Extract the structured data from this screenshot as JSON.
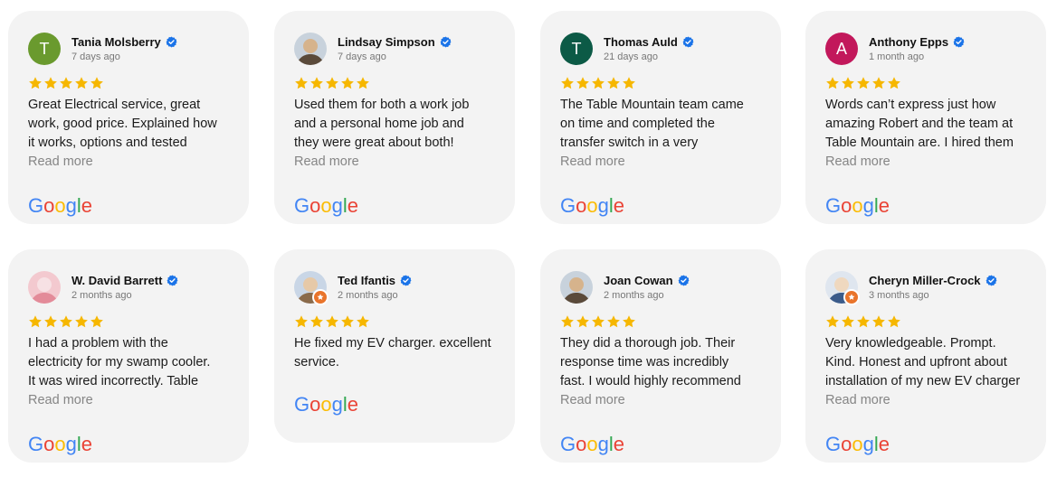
{
  "reviews": [
    {
      "name": "Tania Molsberry",
      "date": "7 days ago",
      "avatar": {
        "type": "initial",
        "letter": "T",
        "color": "#6a9a2e"
      },
      "stars": 5,
      "text": [
        "Great Electrical service, great",
        "work, good price. Explained how",
        "it works, options and tested"
      ],
      "more": "Read more",
      "logo": "Google"
    },
    {
      "name": "Lindsay Simpson",
      "date": "7 days ago",
      "avatar": {
        "type": "photo",
        "icon": "person-photo-icon"
      },
      "stars": 5,
      "text": [
        "Used them for both a work job",
        "and a personal home job and",
        "they were great about both!"
      ],
      "more": "Read more",
      "logo": "Google"
    },
    {
      "name": "Thomas Auld",
      "date": "21 days ago",
      "avatar": {
        "type": "initial",
        "letter": "T",
        "color": "#0c5a46"
      },
      "stars": 5,
      "text": [
        "The Table Mountain team came",
        "on time and completed the",
        "transfer switch in a very"
      ],
      "more": "Read more",
      "logo": "Google"
    },
    {
      "name": "Anthony Epps",
      "date": "1 month ago",
      "avatar": {
        "type": "initial",
        "letter": "A",
        "color": "#c2185b"
      },
      "stars": 5,
      "text": [
        "Words can’t express just how",
        "amazing Robert and the team at",
        "Table Mountain are. I hired them"
      ],
      "more": "Read more",
      "logo": "Google"
    },
    {
      "name": "W. David Barrett",
      "date": "2 months ago",
      "avatar": {
        "type": "photo",
        "icon": "person-photo-icon"
      },
      "stars": 5,
      "text": [
        "I had a problem with the",
        "electricity for my swamp cooler.",
        "It was wired incorrectly. Table"
      ],
      "more": "Read more",
      "logo": "Google"
    },
    {
      "name": "Ted Ifantis",
      "date": "2 months ago",
      "avatar": {
        "type": "photo",
        "icon": "person-photo-icon",
        "badge": true
      },
      "stars": 5,
      "text": [
        "He fixed my EV charger. excellent",
        "service."
      ],
      "more": "",
      "logo": "Google"
    },
    {
      "name": "Joan Cowan",
      "date": "2 months ago",
      "avatar": {
        "type": "photo",
        "icon": "person-photo-icon"
      },
      "stars": 5,
      "text": [
        "They did a thorough job. Their",
        "response time was incredibly",
        "fast. I would highly recommend"
      ],
      "more": "Read more",
      "logo": "Google"
    },
    {
      "name": "Cheryn Miller-Crock",
      "date": "3 months ago",
      "avatar": {
        "type": "photo",
        "icon": "person-photo-icon",
        "badge": true
      },
      "stars": 5,
      "text": [
        "Very knowledgeable. Prompt.",
        "Kind. Honest and upfront about",
        "installation of my new EV charger"
      ],
      "more": "Read more",
      "logo": "Google"
    }
  ],
  "colors": {
    "star": "#f6b700",
    "verified": "#1a73e8",
    "card_bg": "#f3f3f3",
    "google_blue": "#4285F4",
    "google_red": "#EA4335",
    "google_yellow": "#FBBC05",
    "google_green": "#34A853"
  }
}
